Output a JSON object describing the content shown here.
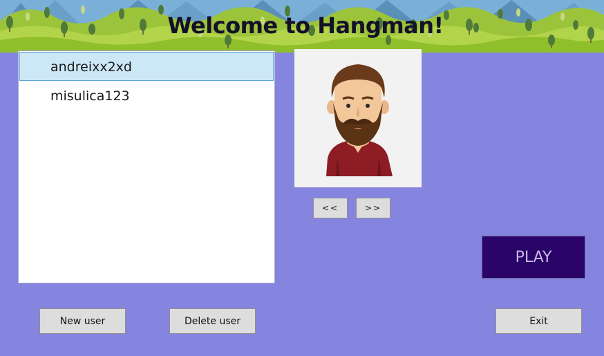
{
  "header": {
    "title": "Welcome to Hangman!"
  },
  "users": {
    "items": [
      "andreixx2xd",
      "misulica123"
    ],
    "selected": "andreixx2xd"
  },
  "avatar": {
    "navigation": {
      "prev_label": "<<",
      "next_label": ">>"
    }
  },
  "actions": {
    "play_label": "PLAY",
    "new_user_label": "New user",
    "delete_user_label": "Delete user",
    "exit_label": "Exit"
  },
  "colors": {
    "background": "#8585e0",
    "play_button": "#2a0468",
    "selection": "#cce8f6"
  }
}
